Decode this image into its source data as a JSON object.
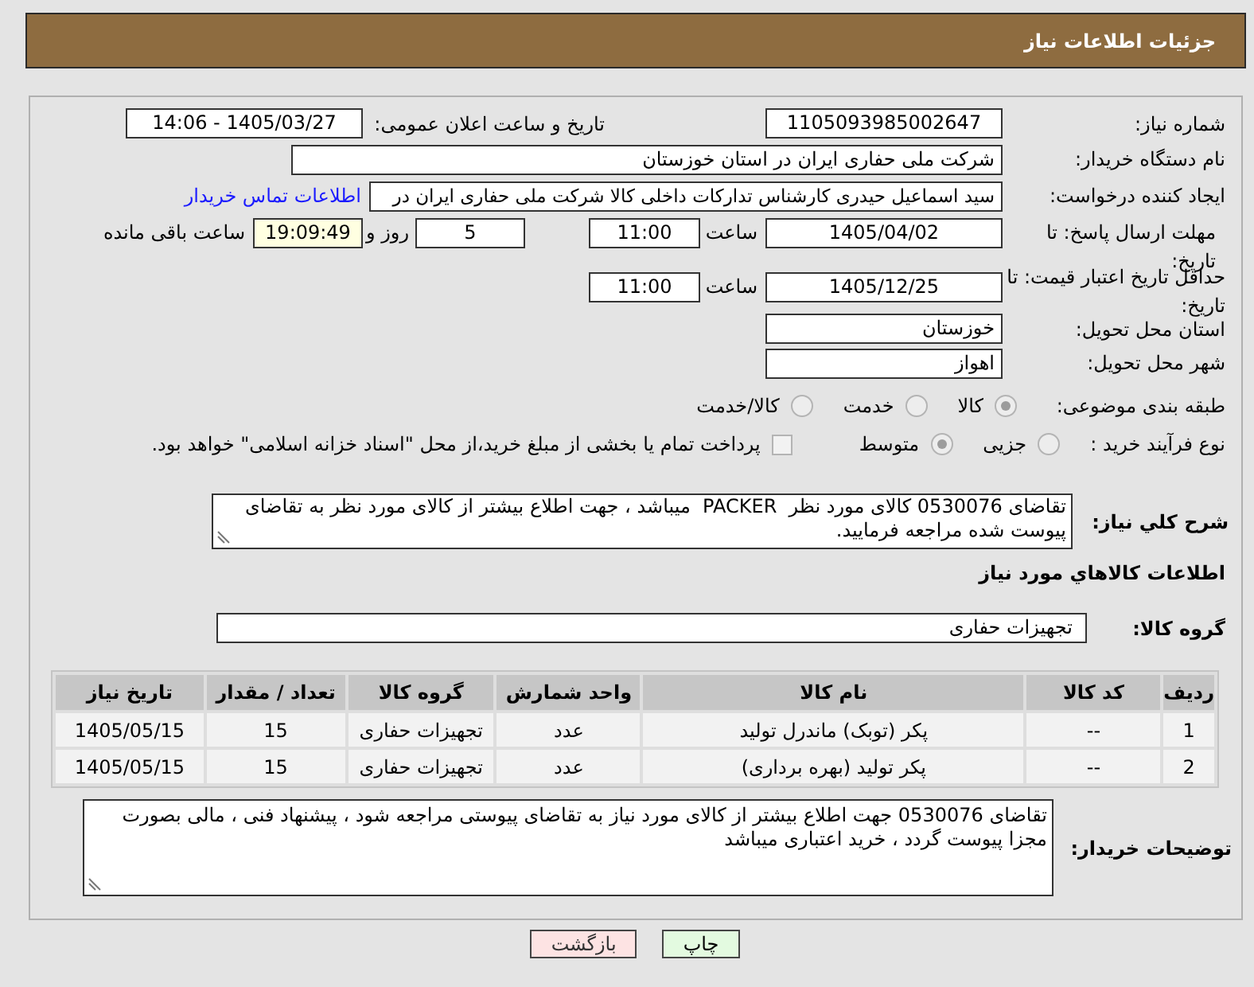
{
  "header": {
    "title": "جزئیات اطلاعات نیاز"
  },
  "need_number": {
    "label": "شماره نیاز:",
    "value": "1105093985002647"
  },
  "announcement": {
    "label": "تاریخ و ساعت اعلان عمومی:",
    "value": "1405/03/27 - 14:06"
  },
  "buyer_org": {
    "label": "نام دستگاه خریدار:",
    "value": "شرکت ملی حفاری ایران در استان خوزستان"
  },
  "requester": {
    "label": "ایجاد کننده درخواست:",
    "value": "سید اسماعیل حیدری کارشناس تدارکات داخلی کالا شرکت ملی حفاری ایران در",
    "link": "اطلاعات تماس خریدار"
  },
  "response_deadline": {
    "label": "مهلت ارسال پاسخ: تا تاریخ:",
    "date": "1405/04/02",
    "time_label": "ساعت",
    "time": "11:00",
    "days": "5",
    "days_label": "روز و",
    "remaining": "19:09:49",
    "remaining_label": "ساعت باقی مانده"
  },
  "price_validity": {
    "label": "حداقل تاریخ اعتبار قیمت: تا تاریخ:",
    "date": "1405/12/25",
    "time_label": "ساعت",
    "time": "11:00"
  },
  "delivery_province": {
    "label": "استان محل تحویل:",
    "value": "خوزستان"
  },
  "delivery_city": {
    "label": "شهر محل تحویل:",
    "value": "اهواز"
  },
  "category": {
    "label": "طبقه بندی موضوعی:",
    "options": [
      {
        "label": "کالا",
        "selected": true
      },
      {
        "label": "خدمت",
        "selected": false
      },
      {
        "label": "کالا/خدمت",
        "selected": false
      }
    ]
  },
  "purchase_process": {
    "label": "نوع فرآیند خرید :",
    "options": [
      {
        "label": "جزیی",
        "selected": false
      },
      {
        "label": "متوسط",
        "selected": true
      }
    ],
    "treasury": {
      "label": "پرداخت تمام یا بخشی از مبلغ خرید،از محل \"اسناد خزانه اسلامی\" خواهد بود.",
      "checked": false
    }
  },
  "description": {
    "label": "شرح کلي نياز:",
    "value": "تقاضای 0530076 کالای مورد نظر  PACKER  میباشد ، جهت اطلاع بیشتر از کالای مورد نظر به تقاضای پیوست شده مراجعه فرمایید."
  },
  "goods_heading": "اطلاعات کالاهاي مورد نياز",
  "goods_group": {
    "label": "گروه کالا:",
    "value": "تجهیزات حفاری"
  },
  "table": {
    "columns": [
      "ردیف",
      "کد کالا",
      "نام کالا",
      "واحد شمارش",
      "گروه کالا",
      "تعداد / مقدار",
      "تاریخ نیاز"
    ],
    "rows": [
      [
        "1",
        "--",
        "پکر (توبک) ماندرل تولید",
        "عدد",
        "تجهیزات حفاری",
        "15",
        "1405/05/15"
      ],
      [
        "2",
        "--",
        "پکر تولید (بهره برداری)",
        "عدد",
        "تجهیزات حفاری",
        "15",
        "1405/05/15"
      ]
    ]
  },
  "buyer_notes": {
    "label": "توضیحات خریدار:",
    "value": "تقاضای 0530076 جهت اطلاع بیشتر از کالای مورد نیاز به تقاضای پیوستی مراجعه شود ، پیشنهاد فنی ، مالی بصورت مجزا پیوست گردد ، خرید اعتباری میباشد"
  },
  "buttons": [
    {
      "label": "چاپ",
      "kind": "print"
    },
    {
      "label": "بازگشت",
      "kind": "back"
    }
  ]
}
